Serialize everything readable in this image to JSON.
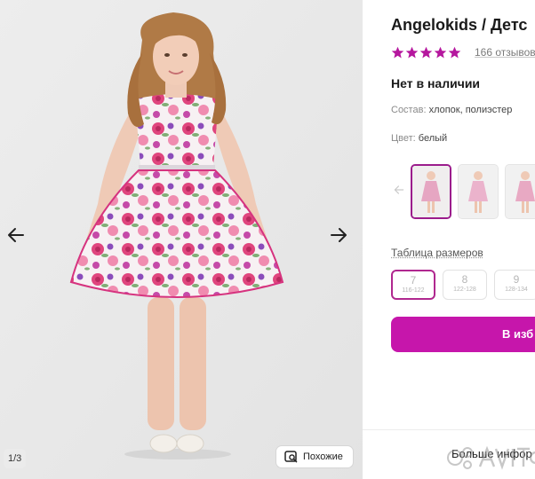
{
  "gallery": {
    "counter": "1/3",
    "similar_label": "Похожие"
  },
  "product": {
    "title": "Angelokids / Детс",
    "rating_stars": 5,
    "reviews": "166 отзывов",
    "availability": "Нет в наличии",
    "composition_label": "Состав:",
    "composition_value": "хлопок, полиэстер",
    "color_label": "Цвет:",
    "color_value": "белый",
    "size_table_link": "Таблица размеров",
    "sizes": [
      {
        "num": "7",
        "range": "116-122"
      },
      {
        "num": "8",
        "range": "122-128"
      },
      {
        "num": "9",
        "range": "128-134"
      }
    ],
    "cart_button": "В изб",
    "more_info": "Больше инфор"
  },
  "colors": {
    "accent": "#c616ab",
    "star": "#b5179e"
  },
  "icons": {
    "prev_photo": "arrow-left-icon",
    "next_photo": "arrow-right-icon",
    "similar": "similar-search-icon",
    "thumb_prev": "arrow-left-icon",
    "star": "star-icon"
  }
}
